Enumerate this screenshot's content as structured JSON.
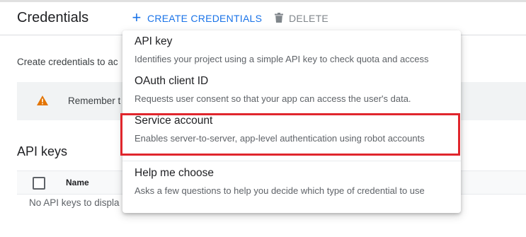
{
  "header": {
    "title": "Credentials",
    "create_label": "CREATE CREDENTIALS",
    "delete_label": "DELETE"
  },
  "intro_text": "Create credentials to ac",
  "banner": {
    "text": "Remember t"
  },
  "api_keys": {
    "title": "API keys",
    "column_name": "Name",
    "empty_text": "No API keys to displa"
  },
  "dropdown": {
    "items": [
      {
        "title": "API key",
        "description": "Identifies your project using a simple API key to check quota and access"
      },
      {
        "title": "OAuth client ID",
        "description": "Requests user consent so that your app can access the user's data."
      },
      {
        "title": "Service account",
        "description": "Enables server-to-server, app-level authentication using robot accounts"
      },
      {
        "title": "Help me choose",
        "description": "Asks a few questions to help you decide which type of credential to use"
      }
    ]
  },
  "colors": {
    "accent": "#1a73e8",
    "warning": "#e37400",
    "highlight_border": "#e0262d"
  },
  "icons": {
    "create": "plus-icon",
    "delete": "trash-icon",
    "banner": "warning-icon"
  }
}
